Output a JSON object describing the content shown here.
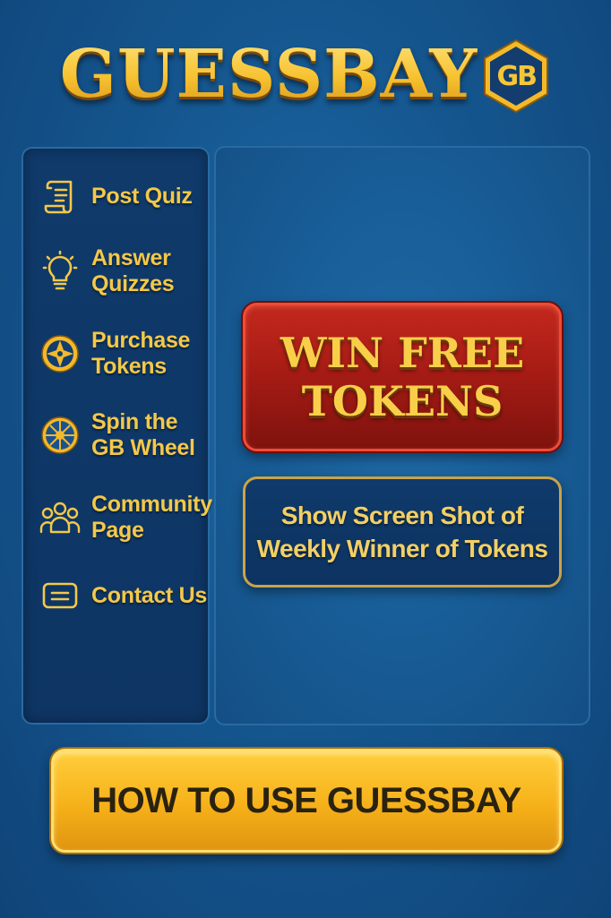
{
  "header": {
    "title": "GUESSBAY",
    "badge_text": "GB"
  },
  "sidebar": {
    "items": [
      {
        "label": "Post Quiz",
        "icon": "scroll-icon"
      },
      {
        "label": "Answer\nQuizzes",
        "icon": "lightbulb-icon"
      },
      {
        "label": "Purchase\nTokens",
        "icon": "token-icon"
      },
      {
        "label": "Spin the\nGB Wheel",
        "icon": "wheel-icon"
      },
      {
        "label": "Community\nPage",
        "icon": "community-icon"
      },
      {
        "label": "Contact Us",
        "icon": "message-icon"
      }
    ]
  },
  "main": {
    "win_button_label": "WIN FREE\nTOKENS",
    "winner_button_label": "Show Screen Shot of\nWeekly Winner of Tokens"
  },
  "footer": {
    "howto_button_label": "HOW TO USE GUESSBAY"
  },
  "colors": {
    "background": "#15568f",
    "gold": "#f3c84a",
    "red_button": "#a41b14",
    "yellow_button": "#f6b119"
  }
}
